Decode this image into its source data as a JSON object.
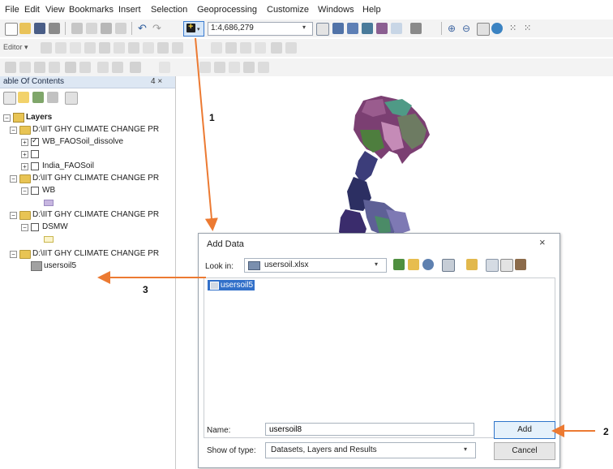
{
  "menu": [
    "File",
    "Edit",
    "View",
    "Bookmarks",
    "Insert",
    "Selection",
    "Geoprocessing",
    "Customize",
    "Windows",
    "Help"
  ],
  "toolbar": {
    "scale": "1:4,686,279",
    "editor_label": "Editor ▾"
  },
  "toc": {
    "title": "able Of Contents",
    "pin": "4 ×",
    "layers_label": "Layers",
    "items": [
      {
        "label": "D:\\IIT GHY CLIMATE CHANGE PR"
      },
      {
        "label": "WB_FAOSoil_dissolve"
      },
      {
        "label": "India_FAOSoil"
      },
      {
        "label": "D:\\IIT GHY CLIMATE CHANGE PR"
      },
      {
        "label": "WB"
      },
      {
        "label": "D:\\IIT GHY CLIMATE CHANGE PR"
      },
      {
        "label": "DSMW"
      },
      {
        "label": "D:\\IIT GHY CLIMATE CHANGE PR"
      },
      {
        "label": "usersoil5"
      }
    ]
  },
  "dialog": {
    "title": "Add Data",
    "close": "×",
    "lookin_label": "Look in:",
    "lookin_value": "usersoil.xlsx",
    "file_item": "usersoil5",
    "name_label": "Name:",
    "name_value": "usersoil8",
    "type_label": "Show of type:",
    "type_value": "Datasets, Layers and Results",
    "add_label": "Add",
    "cancel_label": "Cancel"
  },
  "callouts": [
    "1",
    "2",
    "3"
  ],
  "colors": {
    "accent": "#2f74c9",
    "arrow": "#ec7a32",
    "selection": "#3270c9",
    "toc_header": "#dde7f3"
  }
}
